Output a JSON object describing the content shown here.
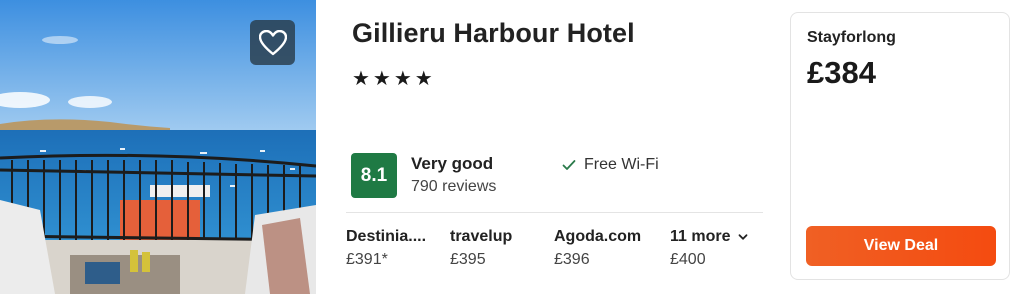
{
  "hotel": {
    "name": "Gillieru Harbour Hotel",
    "stars_text": "★★★★",
    "star_rating": 4
  },
  "rating": {
    "score": "8.1",
    "label": "Very good",
    "reviews": "790 reviews",
    "badge_color": "#1f7a44"
  },
  "amenities": [
    {
      "label": "Free Wi-Fi",
      "icon": "check-icon"
    }
  ],
  "providers": [
    {
      "name": "Destinia....",
      "price": "£391*"
    },
    {
      "name": "travelup",
      "price": "£395"
    },
    {
      "name": "Agoda.com",
      "price": "£396"
    },
    {
      "name": "11 more",
      "price": "£400",
      "icon": "chevron-down-icon"
    }
  ],
  "deal": {
    "provider": "Stayforlong",
    "price": "£384",
    "button_label": "View Deal",
    "button_color": "#f25418"
  },
  "favorite": {
    "icon": "heart-icon"
  }
}
